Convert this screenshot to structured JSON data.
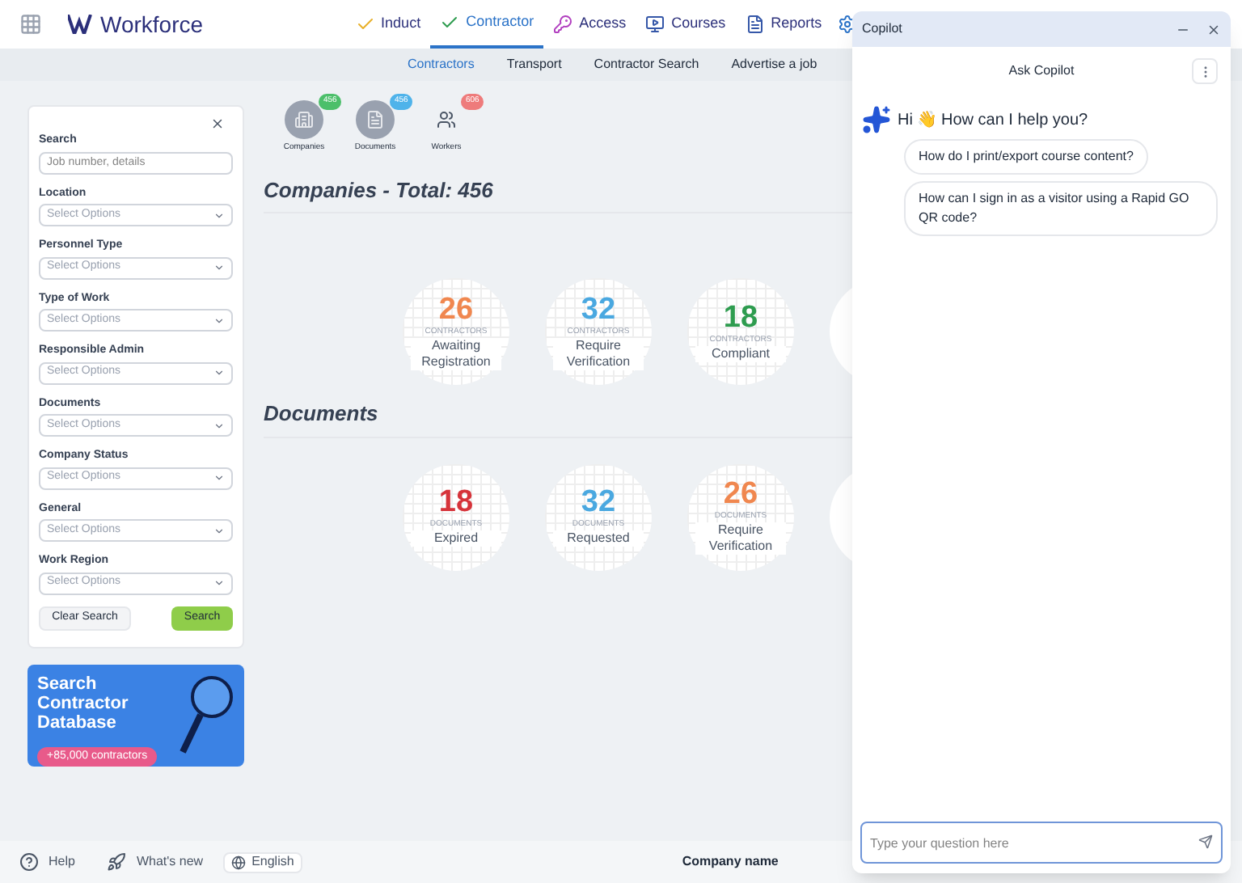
{
  "brand": "Workforce",
  "nav": [
    {
      "label": "Induct",
      "selected": false
    },
    {
      "label": "Contractor",
      "selected": true
    },
    {
      "label": "Access",
      "selected": false
    },
    {
      "label": "Courses",
      "selected": false
    },
    {
      "label": "Reports",
      "selected": false
    }
  ],
  "subnav": [
    {
      "label": "Contractors",
      "selected": true
    },
    {
      "label": "Transport",
      "selected": false
    },
    {
      "label": "Contractor Search",
      "selected": false
    },
    {
      "label": "Advertise a job",
      "selected": false
    }
  ],
  "filters": {
    "search_label": "Search",
    "search_placeholder": "Job number, details",
    "fields": [
      {
        "label": "Location",
        "value": "Select Options"
      },
      {
        "label": "Personnel Type",
        "value": "Select Options"
      },
      {
        "label": "Type of Work",
        "value": "Select Options"
      },
      {
        "label": "Responsible Admin",
        "value": "Select Options"
      },
      {
        "label": "Documents",
        "value": "Select Options"
      },
      {
        "label": "Company Status",
        "value": "Select Options"
      },
      {
        "label": "General",
        "value": "Select Options"
      },
      {
        "label": "Work Region",
        "value": "Select Options"
      }
    ],
    "buttons": [
      "Clear Search",
      "Search"
    ]
  },
  "banner": {
    "title": "Search Contractor Database",
    "badge": "+85,000 contractors"
  },
  "stats": [
    {
      "label": "Companies",
      "count": "456",
      "color": "#4cbf6a"
    },
    {
      "label": "Documents",
      "count": "456",
      "color": "#4fb3ea"
    },
    {
      "label": "Workers",
      "count": "606",
      "color": "#ee7b7b"
    }
  ],
  "sections": [
    {
      "title": "Companies - Total: 456",
      "cards": [
        {
          "value": "26",
          "unit": "CONTRACTORS",
          "label": "Awaiting Registration",
          "color": "#f0874f"
        },
        {
          "value": "32",
          "unit": "CONTRACTORS",
          "label": "Require Verification",
          "color": "#4aa8e0"
        },
        {
          "value": "18",
          "unit": "CONTRACTORS",
          "label": "Compliant",
          "color": "#2e9c4f"
        }
      ]
    },
    {
      "title": "Documents",
      "cards": [
        {
          "value": "18",
          "unit": "DOCUMENTS",
          "label": "Expired",
          "color": "#d6333a"
        },
        {
          "value": "32",
          "unit": "DOCUMENTS",
          "label": "Requested",
          "color": "#4aa8e0"
        },
        {
          "value": "26",
          "unit": "DOCUMENTS",
          "label": "Require Verification",
          "color": "#f0874f"
        }
      ]
    }
  ],
  "footer": {
    "help": "Help",
    "whats_new": "What's new",
    "language": "English",
    "company": "Company name"
  },
  "copilot": {
    "title": "Copilot",
    "subtitle": "Ask Copilot",
    "greeting": "Hi 👋 How can I help you?",
    "suggestions": [
      "How do I print/export course content?",
      "How can I sign in as a visitor using a Rapid GO QR code?"
    ],
    "placeholder": "Type your question here"
  }
}
